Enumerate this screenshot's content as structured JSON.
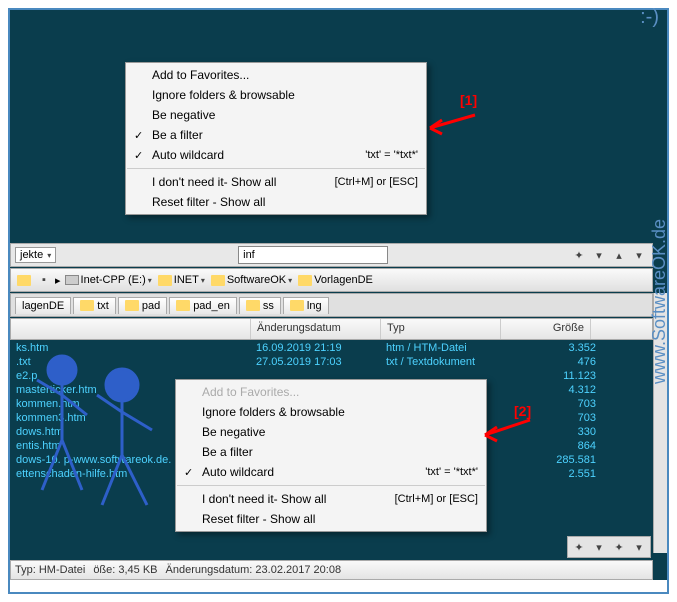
{
  "menu1": {
    "items": [
      {
        "label": "Add to Favorites...",
        "checked": false,
        "shortcut": ""
      },
      {
        "label": "Ignore folders & browsable",
        "checked": false,
        "shortcut": ""
      },
      {
        "label": "Be negative",
        "checked": false,
        "shortcut": ""
      },
      {
        "label": "Be a filter",
        "checked": true,
        "shortcut": ""
      },
      {
        "label": "Auto wildcard",
        "checked": true,
        "shortcut": "'txt' = '*txt*'"
      }
    ],
    "items2": [
      {
        "label": "I don't need it- Show all",
        "shortcut": "[Ctrl+M] or [ESC]"
      },
      {
        "label": "Reset filter - Show all",
        "shortcut": ""
      }
    ]
  },
  "menu2": {
    "items": [
      {
        "label": "Add to Favorites...",
        "checked": false,
        "disabled": true,
        "shortcut": ""
      },
      {
        "label": "Ignore folders & browsable",
        "checked": false,
        "shortcut": ""
      },
      {
        "label": "Be negative",
        "checked": false,
        "shortcut": ""
      },
      {
        "label": "Be a filter",
        "checked": false,
        "shortcut": ""
      },
      {
        "label": "Auto wildcard",
        "checked": true,
        "shortcut": "'txt' = '*txt*'"
      }
    ],
    "items2": [
      {
        "label": "I don't need it- Show all",
        "shortcut": "[Ctrl+M] or [ESC]"
      },
      {
        "label": "Reset filter - Show all",
        "shortcut": ""
      }
    ]
  },
  "toolbar": {
    "dropdown_label": "jekte",
    "search_value": "inf"
  },
  "breadcrumb": {
    "items": [
      "Inet-CPP (E:)",
      "INET",
      "SoftwareOK",
      "VorlagenDE"
    ]
  },
  "tabs": [
    "lagenDE",
    "txt",
    "pad",
    "pad_en",
    "ss",
    "lng"
  ],
  "columns": {
    "name": "",
    "date": "Änderungsdatum",
    "type": "Typ",
    "size": "Größe"
  },
  "files": [
    {
      "name": "ks.htm",
      "date": "16.09.2019 21:19",
      "type": "htm / HTM-Datei",
      "size": "3.352"
    },
    {
      "name": ".txt",
      "date": "27.05.2019 17:03",
      "type": "txt / Textdokument",
      "size": "476"
    },
    {
      "name": "e2.p",
      "date": "",
      "type": "",
      "size": "11.123"
    },
    {
      "name": "masterticker.htm",
      "date": "",
      "type": "",
      "size": "4.312"
    },
    {
      "name": "kommen.htm",
      "date": "",
      "type": "",
      "size": "703"
    },
    {
      "name": "kommen3.htm",
      "date": "",
      "type": "",
      "size": "703"
    },
    {
      "name": "dows.htm",
      "date": "",
      "type": "",
      "size": "330"
    },
    {
      "name": "entis.htm",
      "date": "",
      "type": "",
      "size": "864"
    },
    {
      "name": "dows-10.",
      "extra": "p-www.softwareok.de.",
      "date": "",
      "type": "",
      "size": "285.581"
    },
    {
      "name": "ettenschaden-hilfe.htm",
      "date": "",
      "type": "",
      "size": "2.551"
    }
  ],
  "status": {
    "type_label": "Typ: H",
    "type_value": "M-Datei",
    "size_label": "öße: 3,45 KB",
    "date_label": "Änderungsdatum: 23.02.2017 20:08"
  },
  "annotations": {
    "one": "[1]",
    "two": "[2]"
  },
  "watermark": "www.SoftwareOK.de",
  "smiley": ":-)"
}
